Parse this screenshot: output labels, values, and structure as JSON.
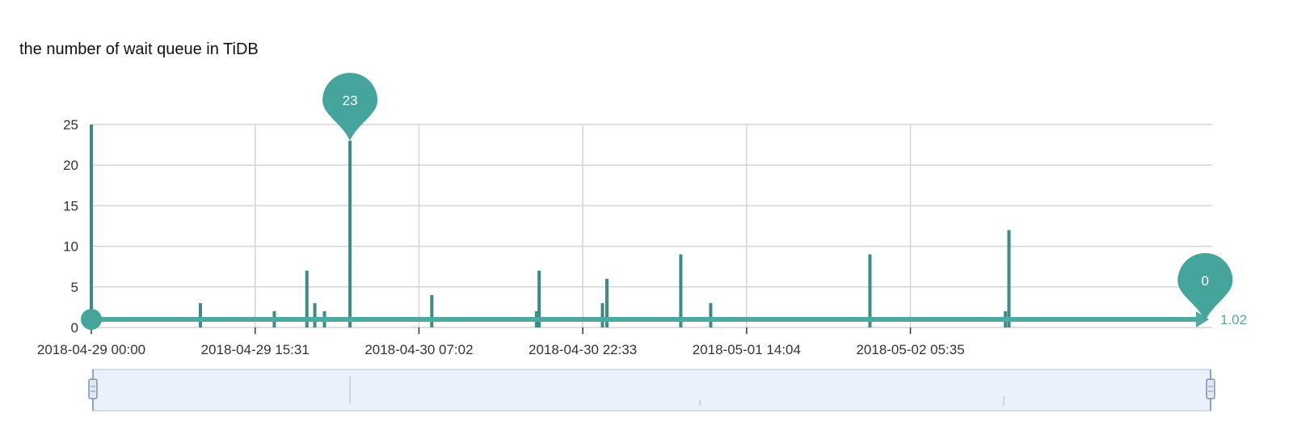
{
  "chart_data": {
    "type": "bar",
    "title": "the number of wait queue in TiDB",
    "xlabel": "",
    "ylabel": "",
    "ylim": [
      0,
      25
    ],
    "y_ticks": [
      0,
      5,
      10,
      15,
      20,
      25
    ],
    "x_range": [
      "2018-04-29 00:00",
      "2018-05-03 10:10"
    ],
    "x_tick_labels": [
      "2018-04-29 00:00",
      "2018-04-29 15:31",
      "2018-04-30 07:02",
      "2018-04-30 22:33",
      "2018-05-01 14:04",
      "2018-05-02 05:35"
    ],
    "grid": true,
    "baseline_value": 1,
    "end_label": "1.02",
    "bars": [
      {
        "time": "2018-04-29 00:00",
        "value": 25
      },
      {
        "time": "2018-04-29 10:20",
        "value": 3
      },
      {
        "time": "2018-04-29 17:20",
        "value": 2
      },
      {
        "time": "2018-04-29 20:25",
        "value": 7
      },
      {
        "time": "2018-04-29 21:10",
        "value": 3
      },
      {
        "time": "2018-04-29 22:05",
        "value": 2
      },
      {
        "time": "2018-04-30 00:30",
        "value": 23
      },
      {
        "time": "2018-04-30 08:15",
        "value": 4
      },
      {
        "time": "2018-04-30 18:10",
        "value": 2
      },
      {
        "time": "2018-04-30 18:25",
        "value": 7
      },
      {
        "time": "2018-05-01 00:25",
        "value": 3
      },
      {
        "time": "2018-05-01 00:50",
        "value": 6
      },
      {
        "time": "2018-05-01 07:50",
        "value": 9
      },
      {
        "time": "2018-05-01 10:40",
        "value": 3
      },
      {
        "time": "2018-05-02 01:45",
        "value": 9
      },
      {
        "time": "2018-05-02 14:35",
        "value": 2
      },
      {
        "time": "2018-05-02 14:55",
        "value": 12
      }
    ],
    "markers": [
      {
        "label": "23",
        "time": "2018-04-30 00:30",
        "value": 23
      },
      {
        "label": "0",
        "time": "2018-05-03 09:30",
        "value": 0
      }
    ],
    "colors": {
      "series": "#3a8c84",
      "marker": "#45a59c",
      "axis_line": "#4fa9a0",
      "grid": "#d4d4d4",
      "slider_fill": "#eaf1fb",
      "slider_border": "#c9d3e2"
    }
  }
}
